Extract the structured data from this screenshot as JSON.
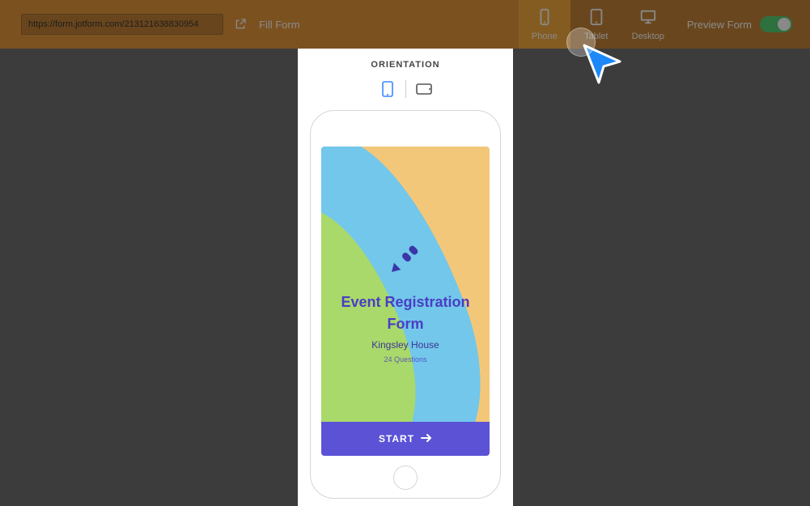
{
  "topbar": {
    "url_value": "https://form.jotform.com/213121638830954",
    "fill_form_label": "Fill Form",
    "devices": {
      "phone": "Phone",
      "tablet": "Tablet",
      "desktop": "Desktop"
    },
    "preview_label": "Preview Form"
  },
  "orientation": {
    "label": "ORIENTATION"
  },
  "form": {
    "title": "Event Registration Form",
    "subtitle": "Kingsley House",
    "questions_label": "24 Questions",
    "start_label": "START"
  },
  "colors": {
    "topbar_bg": "#e28417",
    "device_inactive": "#b96c11",
    "device_active": "#f49b1a",
    "form_primary": "#5b52d6",
    "toggle_on": "#37c759"
  }
}
